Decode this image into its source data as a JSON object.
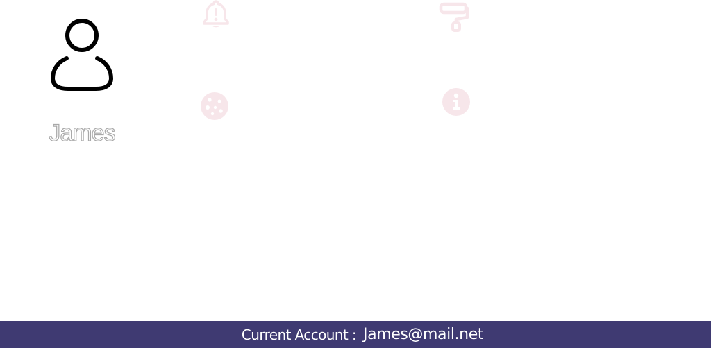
{
  "profile": {
    "name": "James"
  },
  "tiles": [
    {
      "id": "notifications",
      "icon": "bell-icon"
    },
    {
      "id": "appearance",
      "icon": "paint-roller-icon"
    },
    {
      "id": "cookies",
      "icon": "cookie-icon"
    },
    {
      "id": "about",
      "icon": "info-icon"
    }
  ],
  "footer": {
    "label": "Current Account :",
    "email": "James@mail.net"
  },
  "colors": {
    "footer_background": "#3f3a72",
    "icon_tint": "#f7e6ea",
    "avatar_stroke": "#000000",
    "name_outline": "#a8a8a8"
  }
}
